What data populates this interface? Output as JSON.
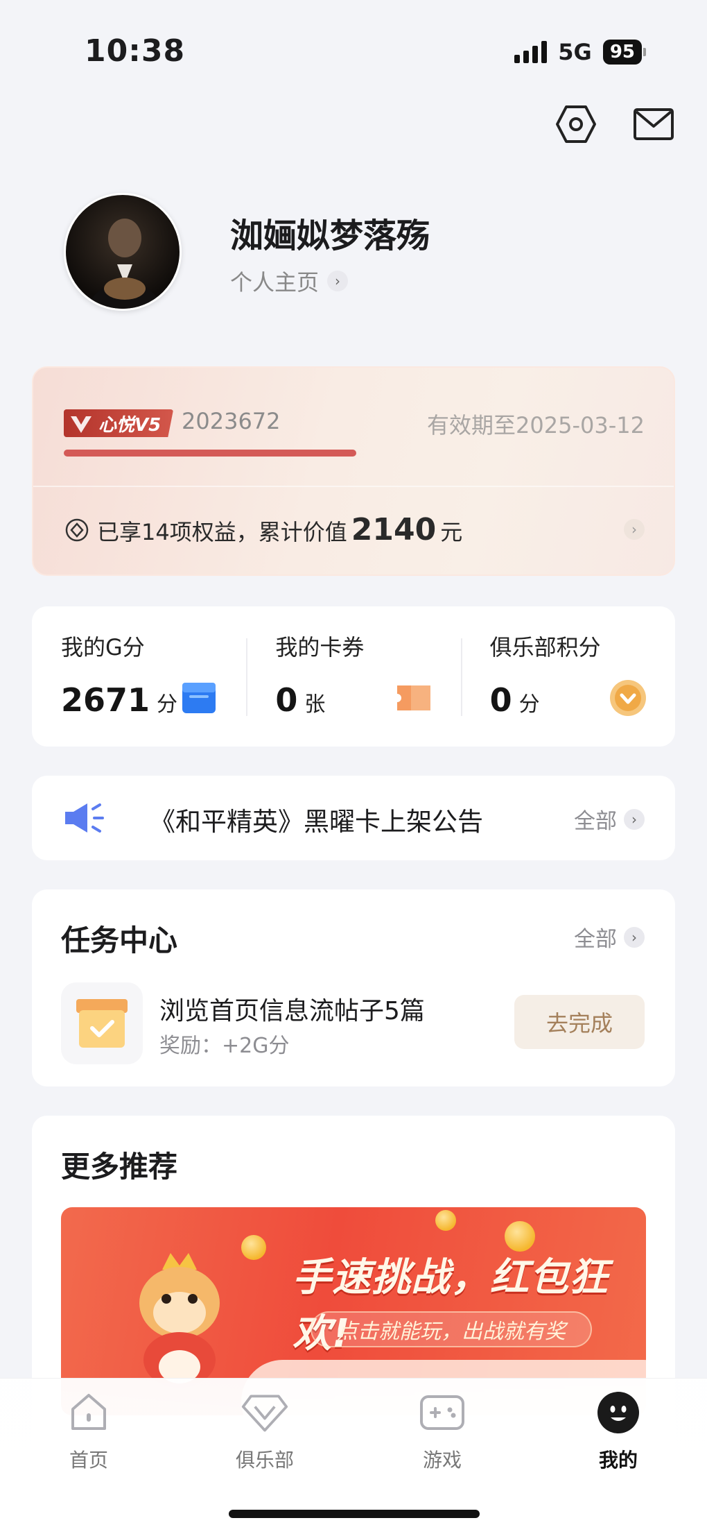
{
  "status_bar": {
    "time": "10:38",
    "network": "5G",
    "battery": "95"
  },
  "profile": {
    "username": "洳婳姒梦落殇",
    "homepage_link": "个人主页"
  },
  "vip": {
    "badge": "心悦V5",
    "id": "2023672",
    "expire": "有效期至2025-03-12",
    "progress": 0.53,
    "benefits_prefix": "已享14项权益，累计价值",
    "benefits_value": "2140",
    "benefits_unit": "元"
  },
  "stats": [
    {
      "label": "我的G分",
      "value": "2671",
      "unit": "分",
      "icon": "g-points-box-icon"
    },
    {
      "label": "我的卡券",
      "value": "0",
      "unit": "张",
      "icon": "coupon-ticket-icon"
    },
    {
      "label": "俱乐部积分",
      "value": "0",
      "unit": "分",
      "icon": "club-points-coin-icon"
    }
  ],
  "announcement": {
    "text": "《和平精英》黑曜卡上架公告",
    "more": "全部"
  },
  "tasks": {
    "title": "任务中心",
    "more": "全部",
    "item": {
      "title": "浏览首页信息流帖子5篇",
      "reward": "奖励：+2G分",
      "button": "去完成"
    }
  },
  "recommendations": {
    "title": "更多推荐",
    "banner": {
      "title": "手速挑战，红包狂欢!",
      "subtitle": "点击就能玩，出战就有奖"
    }
  },
  "nav": [
    {
      "label": "首页",
      "icon": "home-icon",
      "active": false
    },
    {
      "label": "俱乐部",
      "icon": "club-diamond-icon",
      "active": false
    },
    {
      "label": "游戏",
      "icon": "gamepad-icon",
      "active": false
    },
    {
      "label": "我的",
      "icon": "profile-face-icon",
      "active": true
    }
  ],
  "colors": {
    "accent_red": "#d45a57",
    "task_button_text": "#a4805b",
    "announce_blue": "#5b7cf0"
  }
}
